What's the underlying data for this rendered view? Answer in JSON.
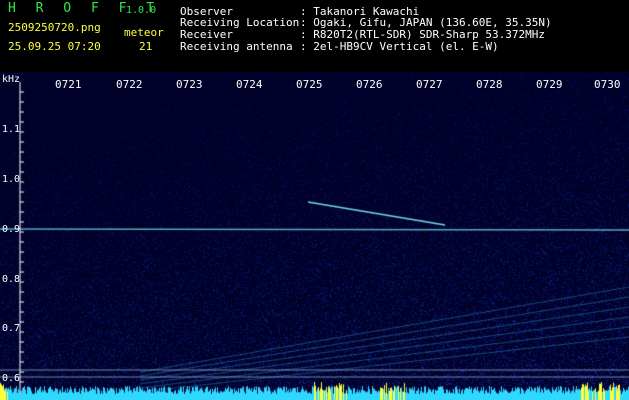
{
  "app": {
    "logo": "H R O F F T",
    "version": "1.0.0"
  },
  "file": {
    "name": "2509250720.png",
    "datetime": "25.09.25 07:20"
  },
  "meteor": {
    "label": "meteor",
    "count": "21"
  },
  "station": [
    {
      "label": "Observer",
      "value": ": Takanori Kawachi"
    },
    {
      "label": "Receiving Location",
      "value": ": Ogaki, Gifu, JAPAN (136.60E, 35.35N)"
    },
    {
      "label": "Receiver",
      "value": ": R820T2(RTL-SDR) SDR-Sharp 53.372MHz"
    },
    {
      "label": "Receiving antenna",
      "value": ": 2el-HB9CV Vertical (el. E-W)"
    }
  ],
  "axis": {
    "unit": "kHz",
    "time_ticks": [
      "0721",
      "0722",
      "0723",
      "0724",
      "0725",
      "0726",
      "0727",
      "0728",
      "0729",
      "0730"
    ],
    "freq_ticks": [
      "1.1",
      "1.0",
      "0.9",
      "0.8",
      "0.7",
      "0.6"
    ]
  },
  "colors": {
    "logo": "#2ee84a",
    "label": "#ffffff",
    "value": "#ffff3c",
    "carrier": "#78f0ff",
    "level": "#2fd8ff",
    "peak": "#ffff3c"
  }
}
